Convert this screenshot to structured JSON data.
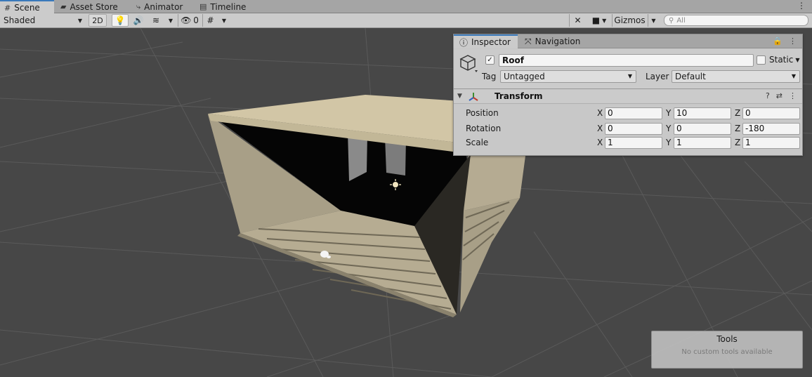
{
  "tabs": [
    {
      "label": "Scene",
      "icon": "grid-icon",
      "active": true
    },
    {
      "label": "Asset Store",
      "icon": "bag-icon",
      "active": false
    },
    {
      "label": "Animator",
      "icon": "animator-icon",
      "active": false
    },
    {
      "label": "Timeline",
      "icon": "film-icon",
      "active": false
    }
  ],
  "toolbar": {
    "shading_mode": "Shaded",
    "toggle_2d": "2D",
    "hidden_count": "0",
    "gizmos_label": "Gizmos",
    "search_placeholder": "All"
  },
  "inspector": {
    "tabs": [
      {
        "label": "Inspector",
        "icon": "info-icon",
        "active": true
      },
      {
        "label": "Navigation",
        "icon": "navigation-icon",
        "active": false
      }
    ],
    "object": {
      "active": true,
      "name": "Roof",
      "static_label": "Static",
      "static": false,
      "tag_label": "Tag",
      "tag_value": "Untagged",
      "layer_label": "Layer",
      "layer_value": "Default"
    },
    "transform": {
      "title": "Transform",
      "rows": [
        {
          "label": "Position",
          "x": "0",
          "y": "10",
          "z": "0"
        },
        {
          "label": "Rotation",
          "x": "0",
          "y": "0",
          "z": "-180"
        },
        {
          "label": "Scale",
          "x": "1",
          "y": "1",
          "z": "1"
        }
      ]
    }
  },
  "tools_overlay": {
    "title": "Tools",
    "message": "No custom tools available"
  },
  "colors": {
    "scene_bg": "#474747",
    "wall": "#a79e88",
    "roof": "#d2c6a6",
    "tab_accent": "#3a79bb"
  }
}
